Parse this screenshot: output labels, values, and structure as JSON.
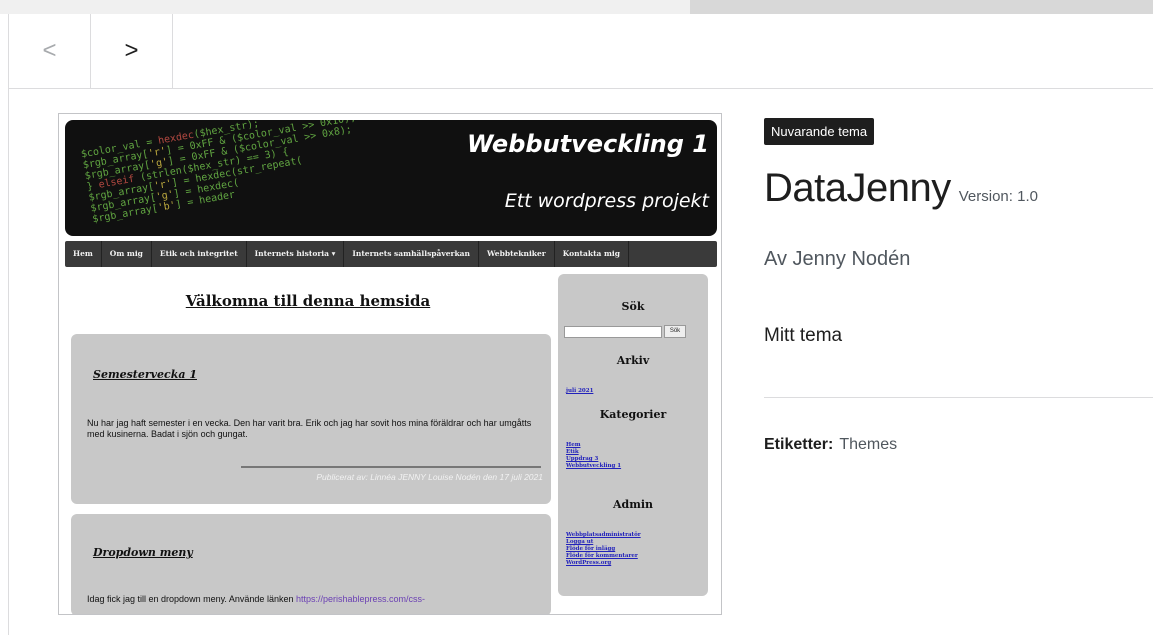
{
  "nav": {
    "prev_icon": "chevron-left-icon",
    "prev_label": "<",
    "next_icon": "chevron-right-icon",
    "next_label": ">"
  },
  "screenshot": {
    "site_title": "Webbutveckling 1",
    "site_subtitle": "Ett wordpress projekt",
    "menu": [
      "Hem",
      "Om mig",
      "Etik och integritet",
      "Internets historia ▾",
      "Internets samhällspåverkan",
      "Webbtekniker",
      "Kontakta mig"
    ],
    "welcome": "Välkomna till denna hemsida",
    "posts": [
      {
        "title": "Semestervecka 1",
        "text": "Nu har jag haft semester i en vecka. Den har varit bra. Erik och jag har sovit hos mina föräldrar och har umgåtts med kusinerna. Badat i sjön och gungat.",
        "published": "Publicerat av: Linnéa JENNY Louise Nodén den 17 juli 2021"
      },
      {
        "title": "Dropdown meny",
        "text": "Idag fick jag till en dropdown meny. Använde länken",
        "link": "https://perishablepress.com/css-"
      }
    ],
    "sidebar": {
      "search_heading": "Sök",
      "search_button": "Sök",
      "archive_heading": "Arkiv",
      "archive_links": [
        "juli 2021"
      ],
      "categories_heading": "Kategorier",
      "category_links": [
        "Hem",
        "Etik",
        "Uppdrag 3",
        "Webbutveckling 1"
      ],
      "admin_heading": "Admin",
      "admin_links": [
        "Webbplatsadministratör",
        "Logga ut",
        "Flöde för inlägg",
        "Flöde för kommentarer",
        "WordPress.org"
      ]
    }
  },
  "theme": {
    "badge": "Nuvarande tema",
    "name": "DataJenny",
    "version": "Version: 1.0",
    "author": "Av Jenny Nodén",
    "description": "Mitt tema",
    "tags_label": "Etiketter:",
    "tags_value": "Themes"
  }
}
